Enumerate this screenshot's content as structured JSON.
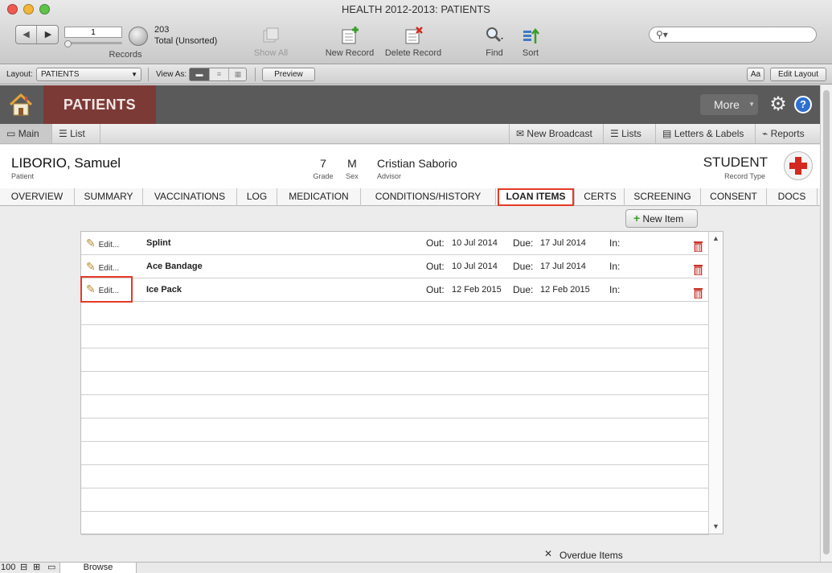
{
  "window": {
    "title": "HEALTH  2012-2013: PATIENTS"
  },
  "toolbar": {
    "record_number": "1",
    "records_label": "Records",
    "found_count": "203",
    "found_status": "Total (Unsorted)",
    "show_all": "Show All",
    "new_record": "New Record",
    "delete_record": "Delete Record",
    "find": "Find",
    "sort": "Sort",
    "search_placeholder": ""
  },
  "layoutbar": {
    "layout_label": "Layout:",
    "layout_value": "PATIENTS",
    "view_as_label": "View As:",
    "preview": "Preview",
    "text_format_icon": "Aa",
    "edit_layout": "Edit Layout"
  },
  "header": {
    "section_title": "PATIENTS",
    "more_button": "More"
  },
  "nav": {
    "main": "Main",
    "list": "List",
    "new_broadcast": "New Broadcast",
    "lists": "Lists",
    "letters_labels": "Letters & Labels",
    "reports": "Reports"
  },
  "record": {
    "patient_name": "LIBORIO, Samuel",
    "patient_label": "Patient",
    "grade": "7",
    "grade_label": "Grade",
    "sex": "M",
    "sex_label": "Sex",
    "advisor": "Cristian Saborio",
    "advisor_label": "Advisor",
    "record_type": "STUDENT",
    "record_type_label": "Record Type"
  },
  "tabs": [
    "OVERVIEW",
    "SUMMARY",
    "VACCINATIONS",
    "LOG",
    "MEDICATION",
    "CONDITIONS/HISTORY",
    "LOAN ITEMS",
    "CERTS",
    "SCREENING",
    "CONSENT",
    "DOCS"
  ],
  "active_tab": "LOAN ITEMS",
  "loan": {
    "new_item": "New Item",
    "edit_label": "Edit...",
    "out_label": "Out:",
    "due_label": "Due:",
    "in_label": "In:",
    "items": [
      {
        "name": "Splint",
        "out": "10 Jul 2014",
        "due": "17 Jul 2014",
        "in": ""
      },
      {
        "name": "Ace Bandage",
        "out": "10 Jul 2014",
        "due": "17 Jul 2014",
        "in": ""
      },
      {
        "name": "Ice Pack",
        "out": "12 Feb 2015",
        "due": "12 Feb 2015",
        "in": ""
      }
    ],
    "overdue_checkbox": "Overdue Items"
  },
  "status": {
    "zoom": "100",
    "mode": "Browse"
  },
  "colors": {
    "accent_red": "#e53a26",
    "patients_band": "#7c3a36",
    "header_band": "#5a5a5a"
  }
}
